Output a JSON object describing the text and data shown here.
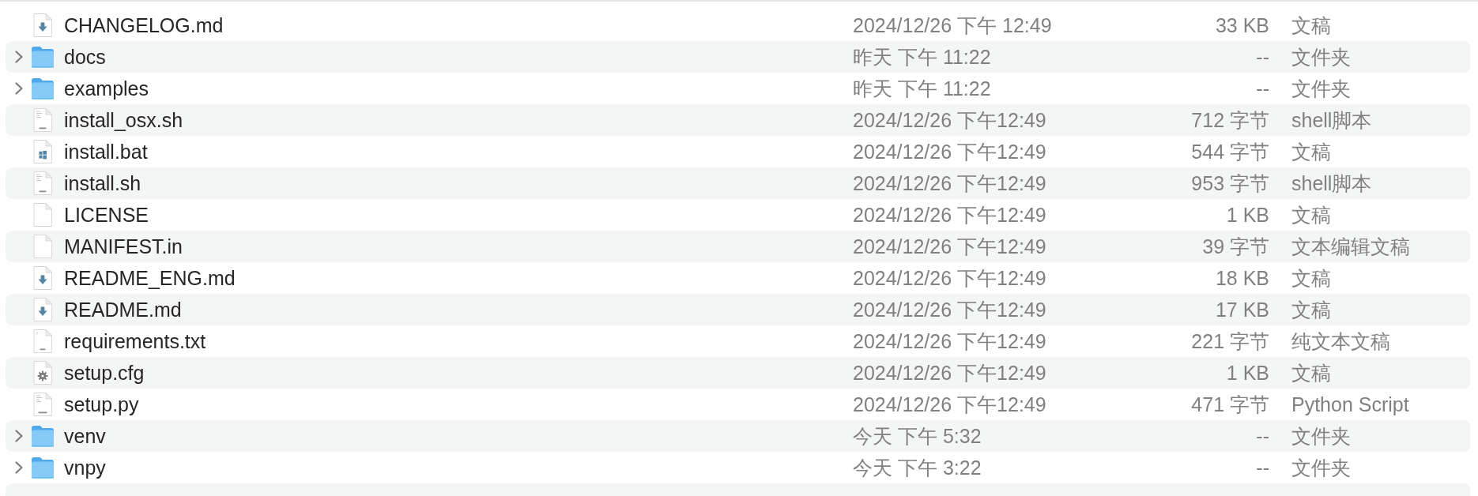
{
  "file_list": {
    "rows": [
      {
        "kind": "markdown",
        "name": "CHANGELOG.md",
        "date": "2024/12/26 下午 12:49",
        "size": "33 KB",
        "type": "文稿",
        "selected": false
      },
      {
        "kind": "folder",
        "expanded": false,
        "name": "docs",
        "date": "昨天 下午 11:22",
        "size": "--",
        "type": "文件夹",
        "selected": false
      },
      {
        "kind": "folder",
        "expanded": false,
        "name": "examples",
        "date": "昨天 下午 11:22",
        "size": "--",
        "type": "文件夹",
        "selected": false
      },
      {
        "kind": "shell-script",
        "name": "install_osx.sh",
        "date": "2024/12/26 下午12:49",
        "size": "712 字节",
        "type": "shell脚本",
        "selected": false
      },
      {
        "kind": "batch",
        "name": "install.bat",
        "date": "2024/12/26 下午12:49",
        "size": "544 字节",
        "type": "文稿",
        "selected": false
      },
      {
        "kind": "shell-script",
        "name": "install.sh",
        "date": "2024/12/26 下午12:49",
        "size": "953 字节",
        "type": "shell脚本",
        "selected": false
      },
      {
        "kind": "plain",
        "name": "LICENSE",
        "date": "2024/12/26 下午12:49",
        "size": "1 KB",
        "type": "文稿",
        "selected": false
      },
      {
        "kind": "plain",
        "name": "MANIFEST.in",
        "date": "2024/12/26 下午12:49",
        "size": "39 字节",
        "type": "文本编辑文稿",
        "selected": false
      },
      {
        "kind": "markdown",
        "name": "README_ENG.md",
        "date": "2024/12/26 下午12:49",
        "size": "18 KB",
        "type": "文稿",
        "selected": false
      },
      {
        "kind": "markdown",
        "name": "README.md",
        "date": "2024/12/26 下午12:49",
        "size": "17 KB",
        "type": "文稿",
        "selected": false
      },
      {
        "kind": "text",
        "name": "requirements.txt",
        "date": "2024/12/26 下午12:49",
        "size": "221 字节",
        "type": "纯文本文稿",
        "selected": false
      },
      {
        "kind": "config",
        "name": "setup.cfg",
        "date": "2024/12/26 下午12:49",
        "size": "1 KB",
        "type": "文稿",
        "selected": false
      },
      {
        "kind": "python",
        "name": "setup.py",
        "date": "2024/12/26 下午12:49",
        "size": "471 字节",
        "type": "Python Script",
        "selected": false
      },
      {
        "kind": "folder",
        "expanded": false,
        "name": "venv",
        "date": "今天 下午 5:32",
        "size": "--",
        "type": "文件夹",
        "selected": false
      },
      {
        "kind": "folder",
        "expanded": false,
        "name": "vnpy",
        "date": "今天 下午 3:22",
        "size": "--",
        "type": "文件夹",
        "selected": false
      }
    ]
  }
}
